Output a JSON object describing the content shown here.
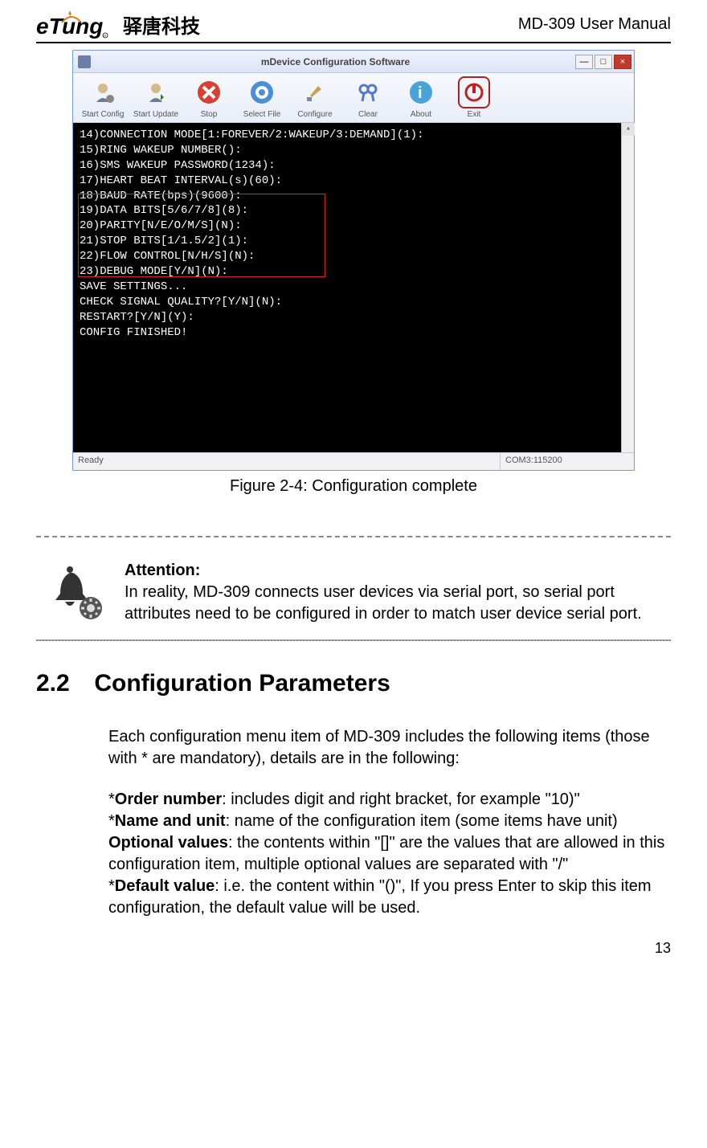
{
  "header": {
    "logo_text_main": "eTung",
    "logo_text_cn": "驿唐科技",
    "manual_title": "MD-309 User Manual"
  },
  "app_window": {
    "title": "mDevice Configuration Software",
    "min_glyph": "—",
    "max_glyph": "□",
    "close_glyph": "×",
    "toolbar": [
      {
        "label": "Start Config"
      },
      {
        "label": "Start Update"
      },
      {
        "label": "Stop"
      },
      {
        "label": "Select File"
      },
      {
        "label": "Configure"
      },
      {
        "label": "Clear"
      },
      {
        "label": "About"
      },
      {
        "label": "Exit"
      }
    ],
    "terminal_lines": [
      "14)CONNECTION MODE[1:FOREVER/2:WAKEUP/3:DEMAND](1):",
      "15)RING WAKEUP NUMBER():",
      "16)SMS WAKEUP PASSWORD(1234):",
      "17)HEART BEAT INTERVAL(s)(60):",
      "18)BAUD RATE(bps)(9600):",
      "19)DATA BITS[5/6/7/8](8):",
      "20)PARITY[N/E/O/M/S](N):",
      "21)STOP BITS[1/1.5/2](1):",
      "22)FLOW CONTROL[N/H/S](N):",
      "23)DEBUG MODE[Y/N](N):",
      "",
      "SAVE SETTINGS...",
      "",
      "CHECK SIGNAL QUALITY?[Y/N](N):",
      "RESTART?[Y/N](Y):",
      "CONFIG FINISHED!"
    ],
    "status_left": "Ready",
    "status_right": "COM3:115200"
  },
  "figure_caption": "Figure 2-4: Configuration complete",
  "attention": {
    "heading": "Attention:",
    "body": "In reality, MD-309 connects user devices via serial port, so serial port attributes need to be configured in order to match user device serial port."
  },
  "section": {
    "number": "2.2",
    "title": "Configuration Parameters"
  },
  "body": {
    "intro": "Each configuration menu item of MD-309 includes the following items (those with * are mandatory), details are in the following:",
    "items": [
      {
        "lead": "*",
        "name": "Order number",
        "desc": ": includes digit and right bracket, for example \"10)\""
      },
      {
        "lead": "*",
        "name": "Name and unit",
        "desc": ": name of the configuration item (some items have unit)"
      },
      {
        "lead": "",
        "name": "Optional values",
        "desc": ": the contents within \"[]\" are the values that are allowed in this configuration item, multiple optional values are separated with \"/\""
      },
      {
        "lead": "*",
        "name": "Default value",
        "desc": ": i.e. the content within \"()\", If you press Enter to skip this item configuration, the default value will be used."
      }
    ]
  },
  "page_number": "13"
}
